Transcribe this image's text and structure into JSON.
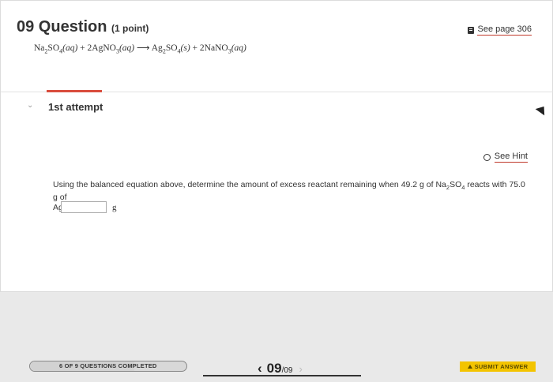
{
  "question": {
    "number": "09 Question",
    "points": "(1 point)",
    "equation": {
      "r1": "Na",
      "r1_sub1": "2",
      "r1b": "SO",
      "r1_sub2": "4",
      "r1_state": "(aq)",
      "plus1": " + ",
      "r2": "2AgNO",
      "r2_sub": "3",
      "r2_state": "(aq)",
      "arrow": " ⟶ ",
      "p1": "Ag",
      "p1_sub1": "2",
      "p1b": "SO",
      "p1_sub2": "4",
      "p1_state": "(s)",
      "plus2": " + ",
      "p2": "2NaNO",
      "p2_sub": "3",
      "p2_state": "(aq)"
    }
  },
  "see_page": "See page 306",
  "attempt_label": "1st attempt",
  "see_hint": "See Hint",
  "problem": {
    "text1": "Using the balanced equation above, determine the amount of excess reactant remaining when 49.2 g of Na",
    "sub1": "2",
    "text2": "SO",
    "sub2": "4",
    "text3": " reacts with 75.0 g of",
    "text4": "AgNO",
    "sub3": "3",
    "text5": "."
  },
  "answer": {
    "value": "",
    "unit": "g"
  },
  "footer": {
    "progress_label": "6 OF 9 QUESTIONS COMPLETED",
    "progress_fraction": 0.6667,
    "prev_icon": "chevron-left-icon",
    "current": "09",
    "total": "/09",
    "next_icon": "chevron-right-icon",
    "submit_label": "SUBMIT ANSWER"
  },
  "colors": {
    "accent_red": "#d94c3d",
    "submit_yellow": "#f3c400"
  }
}
